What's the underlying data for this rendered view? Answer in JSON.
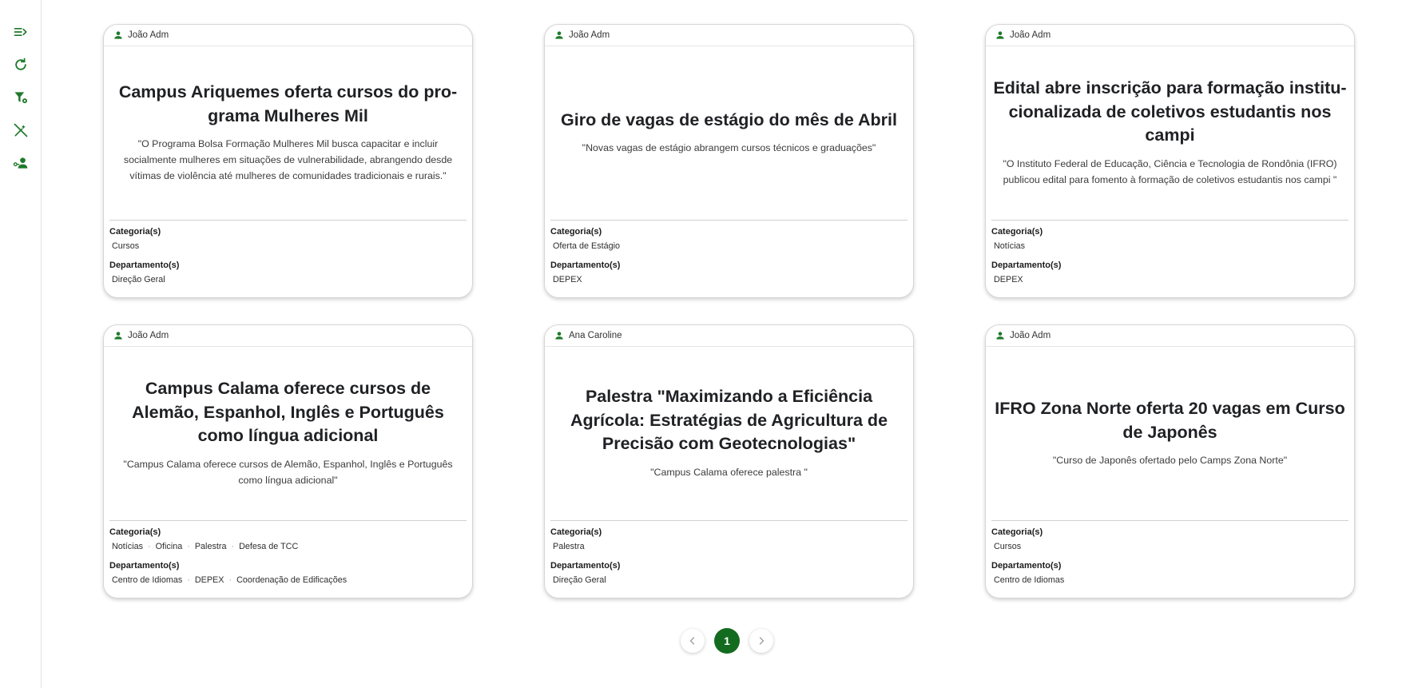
{
  "sidebar": {
    "icons": [
      "menu-open-icon",
      "refresh-icon",
      "filter-settings-icon",
      "magic-wand-off-icon",
      "user-key-icon"
    ]
  },
  "colors": {
    "accent": "#136b1f",
    "icon_green": "#1e7a2a"
  },
  "cards": [
    {
      "author": "João Adm",
      "title": "Campus Ariquemes oferta cursos do pro- grama Mulheres Mil",
      "quote": "\"O Programa Bolsa Formação Mulheres Mil busca capacitar e incluir socialmente mulheres em situações de vulnerabilidade, abrangendo desde vítimas de violência até mulheres de comunidades tradicionais e rurais.\"",
      "categories_label": "Categoria(s)",
      "categories": [
        "Cursos"
      ],
      "departments_label": "Departamento(s)",
      "departments": [
        "Direção Geral"
      ]
    },
    {
      "author": "João Adm",
      "title": "Giro de vagas de estágio do mês de Abril",
      "quote": "\"Novas vagas de estágio abrangem cursos técnicos e graduações\"",
      "categories_label": "Categoria(s)",
      "categories": [
        "Oferta de Estágio"
      ],
      "departments_label": "Departamento(s)",
      "departments": [
        "DEPEX"
      ]
    },
    {
      "author": "João Adm",
      "title": "Edital abre inscrição para formação institu- cionalizada de coletivos estudantis nos campi",
      "quote": "\"O Instituto Federal de Educação, Ciência e Tecnologia de Rondônia (IFRO) publicou edital para fomento à formação de coletivos estudantis nos campi \"",
      "categories_label": "Categoria(s)",
      "categories": [
        "Notícias"
      ],
      "departments_label": "Departamento(s)",
      "departments": [
        "DEPEX"
      ]
    },
    {
      "author": "João Adm",
      "title": "Campus Calama oferece cursos de Alemão, Espanhol, Inglês e Português como língua adicional",
      "quote": "\"Campus Calama oferece cursos de Alemão, Espanhol, Inglês e Português como língua adicional\"",
      "categories_label": "Categoria(s)",
      "categories": [
        "Notícias",
        "Oficina",
        "Palestra",
        "Defesa de TCC"
      ],
      "departments_label": "Departamento(s)",
      "departments": [
        "Centro de Idiomas",
        "DEPEX",
        "Coordenação de Edificações"
      ]
    },
    {
      "author": "Ana Caroline",
      "title": "Palestra \"Maximizando a Eficiência Agrícola: Estratégias de Agricultura de Precisão com Geotecnologias\"",
      "quote": "\"Campus Calama oferece palestra \"",
      "categories_label": "Categoria(s)",
      "categories": [
        "Palestra"
      ],
      "departments_label": "Departamento(s)",
      "departments": [
        "Direção Geral"
      ]
    },
    {
      "author": "João Adm",
      "title": "IFRO Zona Norte oferta 20 vagas em Curso de Japonês",
      "quote": "\"Curso de Japonês ofertado pelo Camps Zona Norte\"",
      "categories_label": "Categoria(s)",
      "categories": [
        "Cursos"
      ],
      "departments_label": "Departamento(s)",
      "departments": [
        "Centro de Idiomas"
      ]
    }
  ],
  "pagination": {
    "current_page": "1",
    "prev_icon": "chevron-left-icon",
    "next_icon": "chevron-right-icon"
  }
}
